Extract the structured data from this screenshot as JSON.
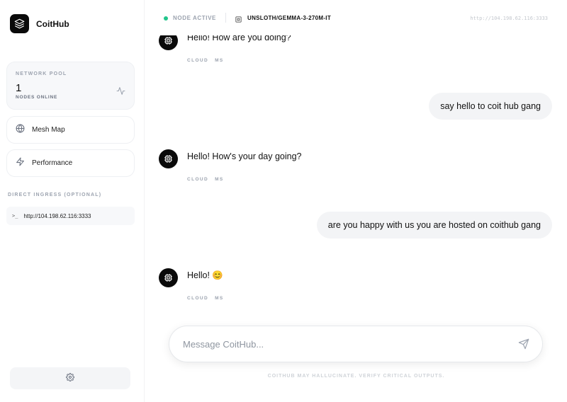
{
  "brand": {
    "name": "CoitHub",
    "icon": "layers-icon"
  },
  "sidebar": {
    "pool": {
      "title": "NETWORK POOL",
      "count": "1",
      "subtitle": "NODES ONLINE",
      "icon": "activity-icon"
    },
    "nav": [
      {
        "label": "Mesh Map",
        "icon": "globe-icon"
      },
      {
        "label": "Performance",
        "icon": "lightning-icon"
      }
    ],
    "ingress": {
      "title": "DIRECT INGRESS (OPTIONAL)",
      "prompt": ">_",
      "value": "http://104.198.62.116:3333"
    },
    "settings_icon": "gear-icon"
  },
  "topbar": {
    "status": "NODE ACTIVE",
    "status_color": "#22c58b",
    "model": "UNSLOTH/GEMMA-3-270M-IT",
    "endpoint": "http://104.198.62.116:3333"
  },
  "messages": [
    {
      "role": "ai",
      "text": "Hello! How are you doing?",
      "meta": [
        "CLOUD",
        "MS"
      ]
    },
    {
      "role": "user",
      "text": "say hello to coit hub gang"
    },
    {
      "role": "ai",
      "text": "Hello! How's your day going?",
      "meta": [
        "CLOUD",
        "MS"
      ]
    },
    {
      "role": "user",
      "text": "are you happy with us you are hosted on coithub gang"
    },
    {
      "role": "ai",
      "text": "Hello! 😊",
      "meta": [
        "CLOUD",
        "MS"
      ]
    }
  ],
  "composer": {
    "placeholder": "Message CoitHub...",
    "send_icon": "send-icon"
  },
  "disclaimer": "COITHUB MAY HALLUCINATE. VERIFY CRITICAL OUTPUTS."
}
